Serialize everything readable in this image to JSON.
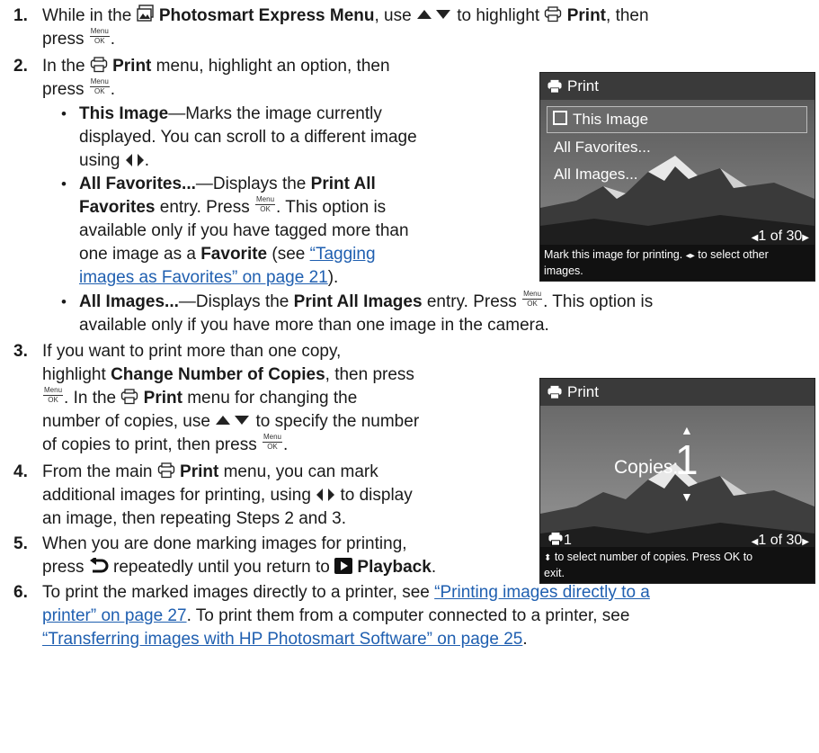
{
  "steps": {
    "s1": {
      "num": "1.",
      "a": "While in the ",
      "menu": "Photosmart Express Menu",
      "b": ", use ",
      "c": " to highlight ",
      "print": "Print",
      "d": ", then",
      "e": "press ",
      "f": "."
    },
    "s2": {
      "num": "2.",
      "a": "In the ",
      "print": "Print",
      "b": " menu, highlight an option, then",
      "c": "press ",
      "d": "."
    },
    "b1": {
      "title": "This Image",
      "l1": "—Marks the image currently",
      "l2": "displayed. You can scroll to a different image",
      "l3a": "using ",
      "l3b": "."
    },
    "b2": {
      "title": "All Favorites...",
      "l1a": "—Displays the ",
      "l1b": "Print All",
      "l2a": "Favorites",
      "l2b": " entry. Press ",
      "l2c": ". This option is",
      "l3": "available only if you have tagged more than",
      "l4a": "one image as a ",
      "l4b": "Favorite",
      "l4c": " (see ",
      "link1": "“Tagging",
      "link2": "images as Favorites” on page 21",
      "l5b": ")."
    },
    "b3": {
      "title": "All Images...",
      "l1a": "—Displays the ",
      "l1b": "Print All Images",
      "l1c": " entry. Press ",
      "l1d": ". This option is",
      "l2": "available only if you have more than one image in the camera."
    },
    "s3": {
      "num": "3.",
      "l1": "If you want to print more than one copy,",
      "l2a": "highlight ",
      "l2b": "Change Number of Copies",
      "l2c": ", then press",
      "l3a": ". In the ",
      "l3b": "Print",
      "l3c": " menu for changing the",
      "l4a": "number of copies, use ",
      "l4b": " to specify the number",
      "l5a": "of copies to print, then press ",
      "l5b": "."
    },
    "s4": {
      "num": "4.",
      "l1a": "From the main ",
      "l1b": "Print",
      "l1c": " menu, you can mark",
      "l2a": "additional images for printing, using ",
      "l2b": " to display",
      "l3": "an image, then repeating Steps 2 and 3."
    },
    "s5": {
      "num": "5.",
      "l1": "When you are done marking images for printing,",
      "l2a": "press ",
      "l2b": " repeatedly until you return to ",
      "l2c": "Playback",
      "l2d": "."
    },
    "s6": {
      "num": "6.",
      "l1a": "To print the marked images directly to a printer, see ",
      "link1": "“Printing images directly to a",
      "link2": "printer” on page 27",
      "l2b": ". To print them from a computer connected to a printer, see",
      "link3": "“Transferring images with HP Photosmart Software” on page 25",
      "l3b": "."
    }
  },
  "menu_ok": {
    "top": "Menu",
    "bottom": "OK"
  },
  "screen1": {
    "title": "Print",
    "options": [
      "This Image",
      "All Favorites...",
      "All Images..."
    ],
    "counter": "1 of 30",
    "hint1": "Mark this image for printing.",
    "hint2": "to select other",
    "hint3": "images."
  },
  "screen2": {
    "title": "Print",
    "copies_label": "Copies:",
    "copies_value": "1",
    "printer_count": "1",
    "counter": "1 of 30",
    "hint1": "to select number of copies. Press OK to",
    "hint2": "exit."
  },
  "colors": {
    "link": "#1f5fb0",
    "screen_title_bg": "#3a3a3a",
    "highlight": "#7d7d7d"
  }
}
